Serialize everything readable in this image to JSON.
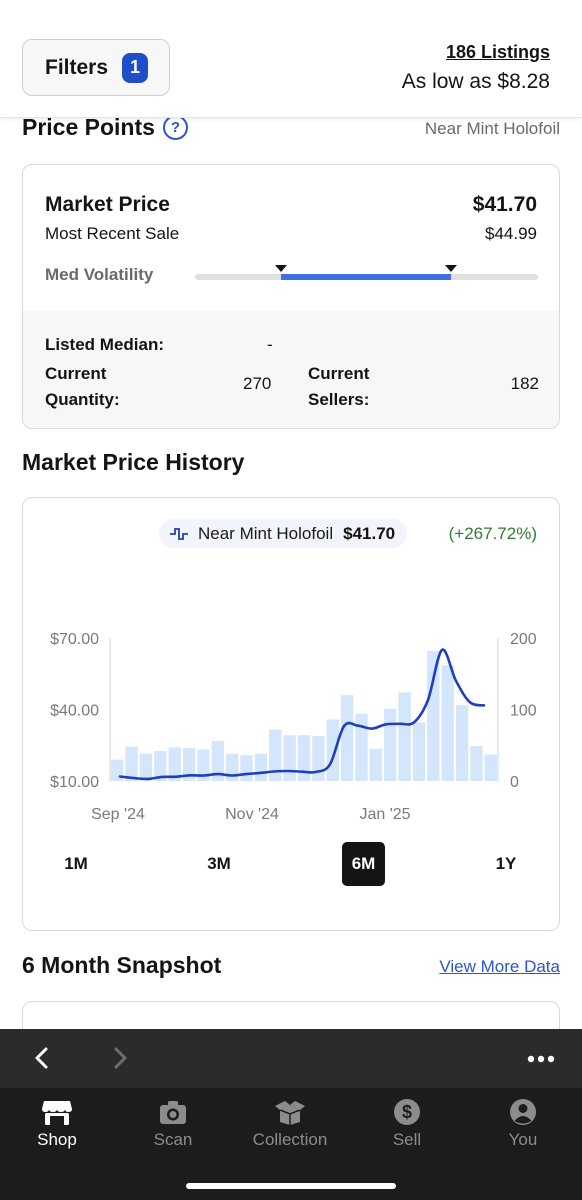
{
  "header": {
    "filters_label": "Filters",
    "filters_count": "1",
    "listings_link": "186 Listings",
    "low_price": "As low as $8.28"
  },
  "price_points": {
    "title": "Price Points",
    "help_icon": "help-circle-icon",
    "condition": "Near Mint Holofoil",
    "market_price_label": "Market Price",
    "market_price_value": "$41.70",
    "recent_sale_label": "Most Recent Sale",
    "recent_sale_value": "$44.99",
    "volatility_label": "Med Volatility",
    "listed_median_label": "Listed Median:",
    "listed_median_value": "-",
    "current_quantity_label": "Current Quantity:",
    "current_quantity_value": "270",
    "current_sellers_label": "Current Sellers:",
    "current_sellers_value": "182"
  },
  "history": {
    "title": "Market Price History",
    "legend_name": "Near Mint Holofoil",
    "legend_price": "$41.70",
    "legend_change": "(+267.72%)",
    "ranges": [
      "1M",
      "3M",
      "6M",
      "1Y"
    ],
    "active_range": "6M"
  },
  "chart_data": {
    "type": "line",
    "title": "",
    "x_ticks": [
      "Sep '24",
      "Nov '24",
      "Jan '25"
    ],
    "y_left_ticks": [
      "$10.00",
      "$40.00",
      "$70.00"
    ],
    "y_left_range": [
      10,
      70
    ],
    "y_right_ticks": [
      "0",
      "100",
      "200"
    ],
    "y_right_range": [
      0,
      200
    ],
    "series": [
      {
        "name": "Near Mint Holofoil",
        "axis": "left",
        "kind": "line",
        "color": "#1f3fbf",
        "values": [
          11.9,
          11.2,
          10.9,
          11.7,
          11.8,
          12.4,
          12.3,
          12.9,
          12.3,
          12.9,
          13.4,
          14.0,
          14.2,
          13.9,
          13.8,
          17.0,
          33.0,
          33.2,
          32.0,
          33.8,
          34.0,
          34.6,
          44.0,
          65.0,
          52.0,
          43.0,
          41.7
        ]
      },
      {
        "name": "",
        "axis": "right",
        "kind": "bar",
        "color": "#d4e6fb",
        "values": [
          30,
          48,
          38,
          42,
          47,
          46,
          44,
          56,
          38,
          36,
          38,
          72,
          64,
          64,
          63,
          86,
          120,
          94,
          45,
          101,
          124,
          82,
          182,
          162,
          106,
          49,
          37
        ]
      }
    ]
  },
  "snapshot": {
    "title": "6 Month Snapshot",
    "view_more": "View More Data"
  },
  "browser": {
    "back_icon": "chevron-left-icon",
    "forward_icon": "chevron-right-icon",
    "more_icon": "more-horizontal-icon"
  },
  "tabbar": {
    "items": [
      {
        "label": "Shop",
        "icon": "shop-icon",
        "active": true
      },
      {
        "label": "Scan",
        "icon": "camera-icon",
        "active": false
      },
      {
        "label": "Collection",
        "icon": "collection-box-icon",
        "active": false
      },
      {
        "label": "Sell",
        "icon": "dollar-icon",
        "active": false
      },
      {
        "label": "You",
        "icon": "user-icon",
        "active": false
      }
    ]
  }
}
